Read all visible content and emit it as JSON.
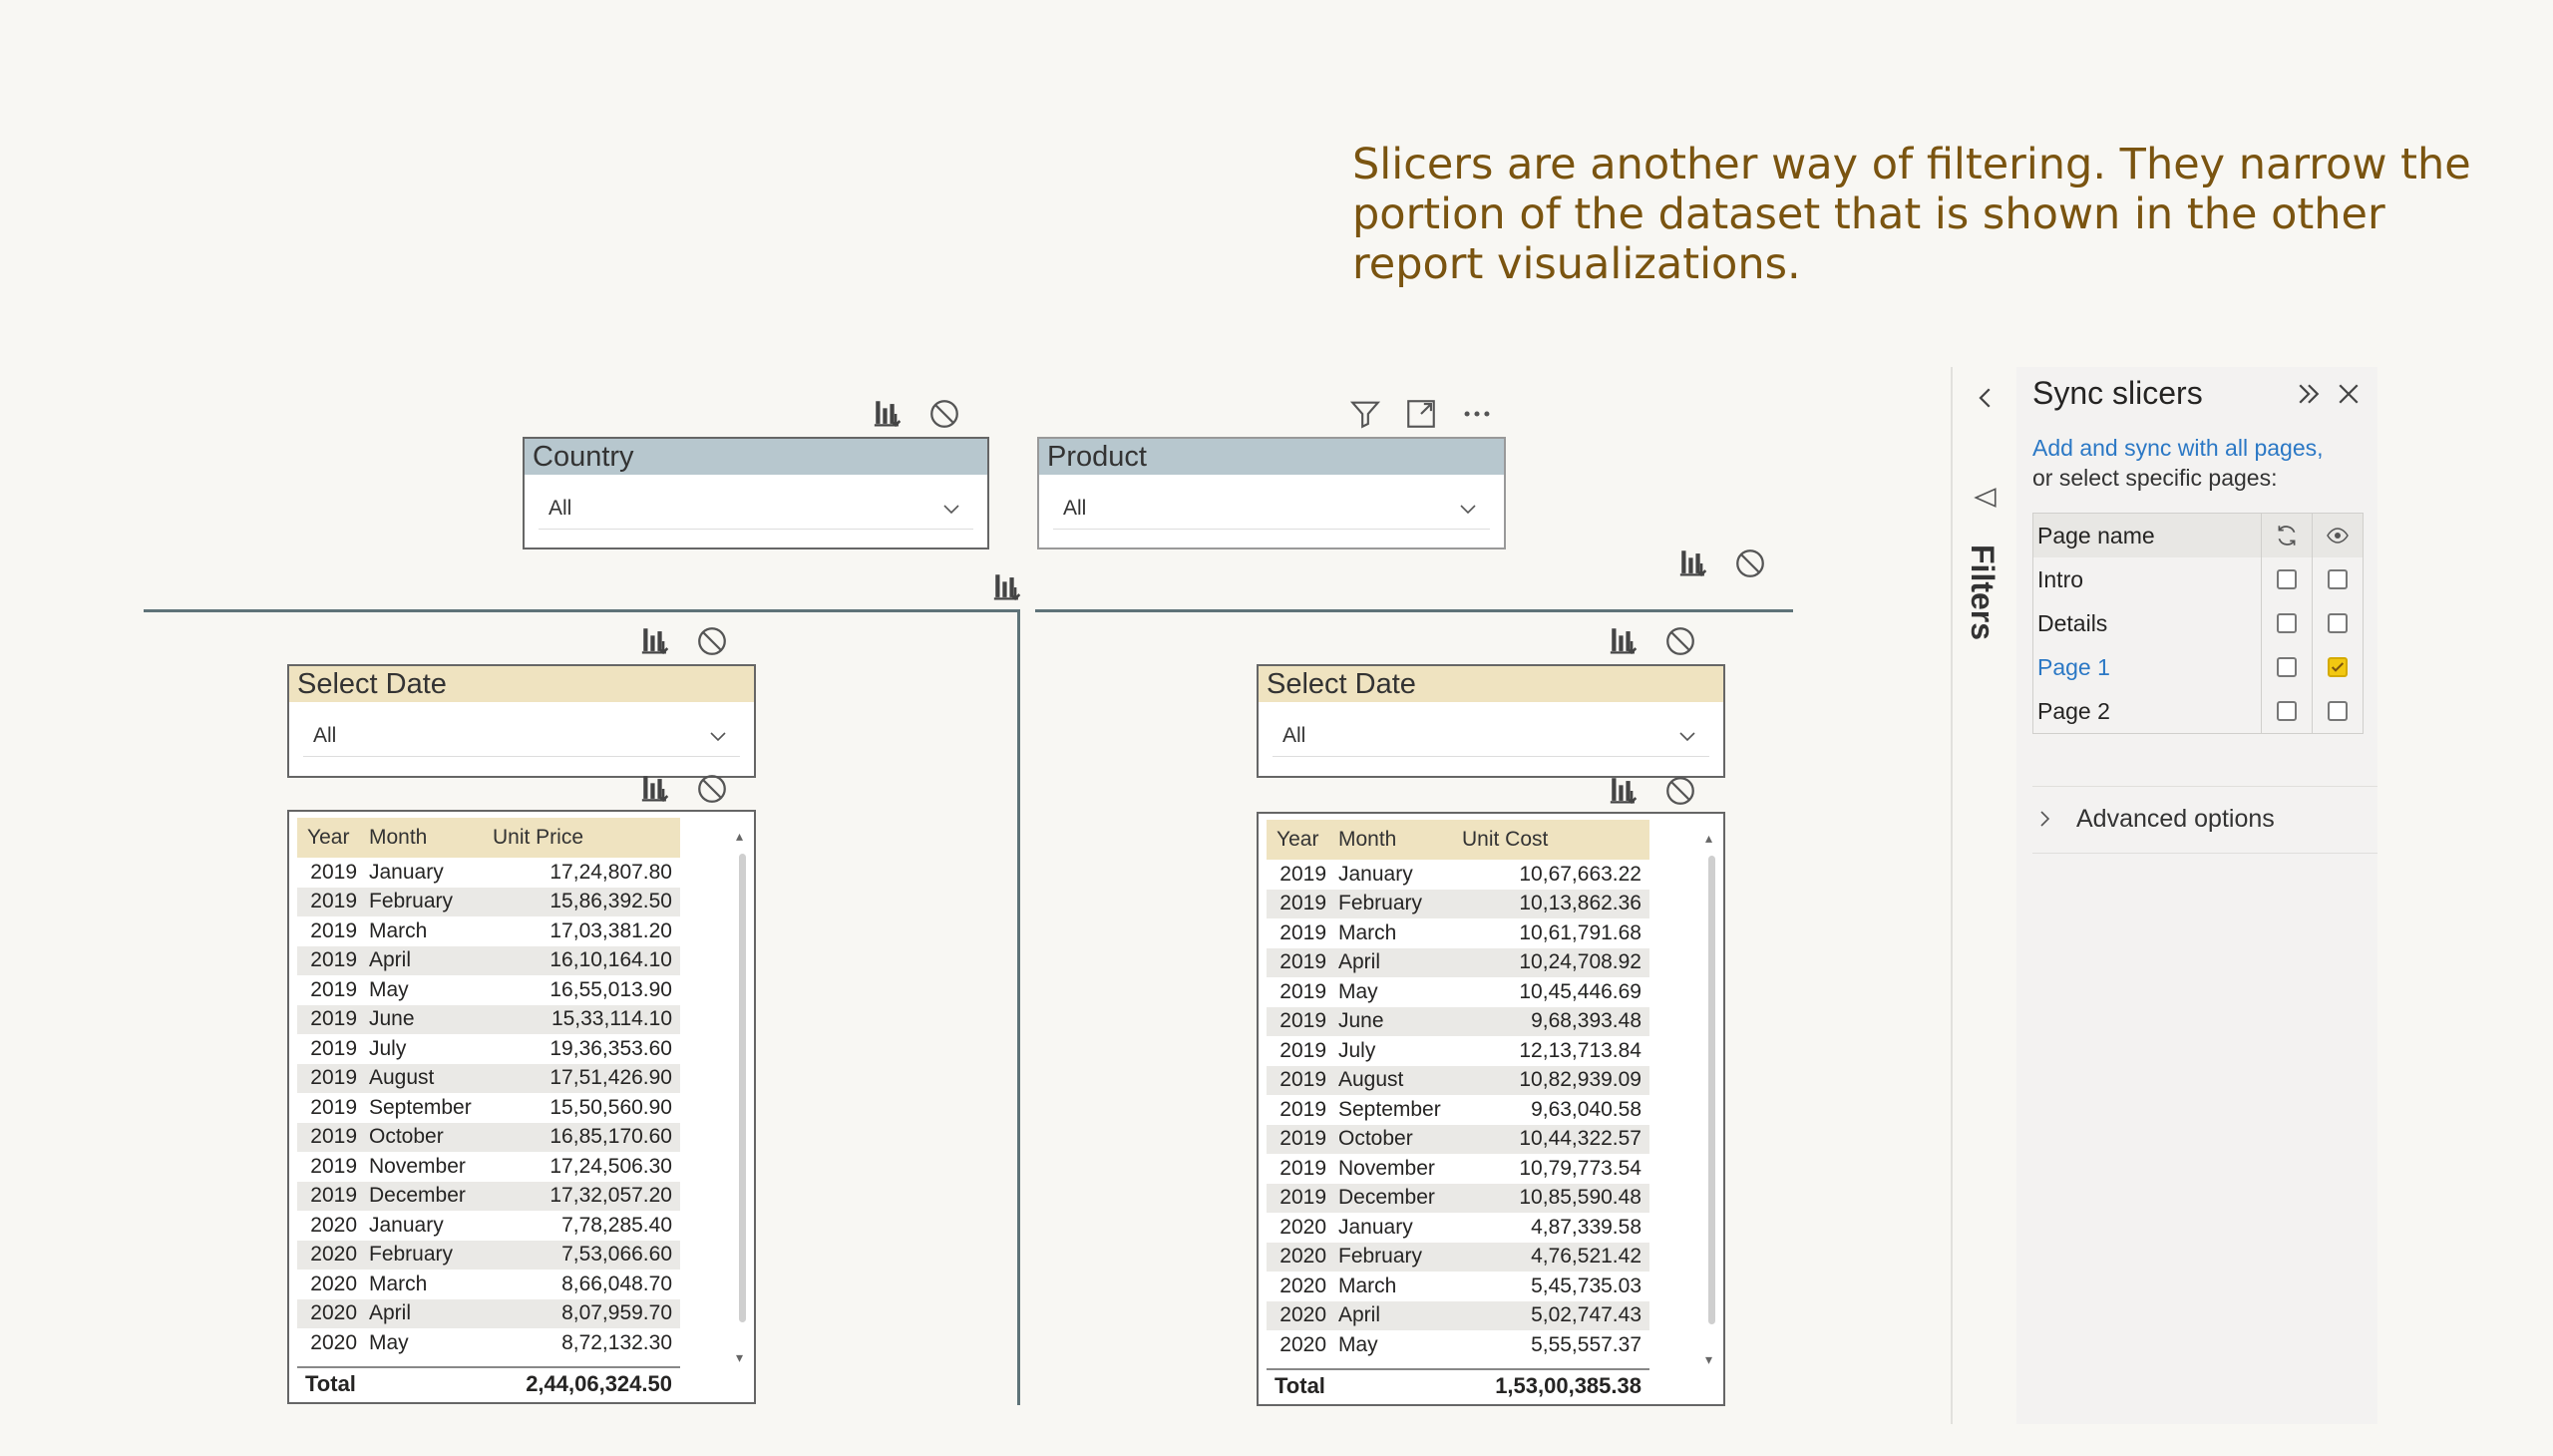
{
  "caption": "Slicers are another way of filtering. They narrow the portion of the dataset that is shown in the other report visualizations.",
  "slicers": {
    "country": {
      "title": "Country",
      "value": "All"
    },
    "product": {
      "title": "Product",
      "value": "All"
    },
    "date_left": {
      "title": "Select Date",
      "value": "All"
    },
    "date_right": {
      "title": "Select Date",
      "value": "All"
    }
  },
  "table_left": {
    "headers": [
      "Year",
      "Month",
      "Unit Price"
    ],
    "rows": [
      [
        "2019",
        "January",
        "17,24,807.80"
      ],
      [
        "2019",
        "February",
        "15,86,392.50"
      ],
      [
        "2019",
        "March",
        "17,03,381.20"
      ],
      [
        "2019",
        "April",
        "16,10,164.10"
      ],
      [
        "2019",
        "May",
        "16,55,013.90"
      ],
      [
        "2019",
        "June",
        "15,33,114.10"
      ],
      [
        "2019",
        "July",
        "19,36,353.60"
      ],
      [
        "2019",
        "August",
        "17,51,426.90"
      ],
      [
        "2019",
        "September",
        "15,50,560.90"
      ],
      [
        "2019",
        "October",
        "16,85,170.60"
      ],
      [
        "2019",
        "November",
        "17,24,506.30"
      ],
      [
        "2019",
        "December",
        "17,32,057.20"
      ],
      [
        "2020",
        "January",
        "7,78,285.40"
      ],
      [
        "2020",
        "February",
        "7,53,066.60"
      ],
      [
        "2020",
        "March",
        "8,66,048.70"
      ],
      [
        "2020",
        "April",
        "8,07,959.70"
      ],
      [
        "2020",
        "May",
        "8,72,132.30"
      ]
    ],
    "total_label": "Total",
    "total_value": "2,44,06,324.50"
  },
  "table_right": {
    "headers": [
      "Year",
      "Month",
      "Unit Cost"
    ],
    "rows": [
      [
        "2019",
        "January",
        "10,67,663.22"
      ],
      [
        "2019",
        "February",
        "10,13,862.36"
      ],
      [
        "2019",
        "March",
        "10,61,791.68"
      ],
      [
        "2019",
        "April",
        "10,24,708.92"
      ],
      [
        "2019",
        "May",
        "10,45,446.69"
      ],
      [
        "2019",
        "June",
        "9,68,393.48"
      ],
      [
        "2019",
        "July",
        "12,13,713.84"
      ],
      [
        "2019",
        "August",
        "10,82,939.09"
      ],
      [
        "2019",
        "September",
        "9,63,040.58"
      ],
      [
        "2019",
        "October",
        "10,44,322.57"
      ],
      [
        "2019",
        "November",
        "10,79,773.54"
      ],
      [
        "2019",
        "December",
        "10,85,590.48"
      ],
      [
        "2020",
        "January",
        "4,87,339.58"
      ],
      [
        "2020",
        "February",
        "4,76,521.42"
      ],
      [
        "2020",
        "March",
        "5,45,735.03"
      ],
      [
        "2020",
        "April",
        "5,02,747.43"
      ],
      [
        "2020",
        "May",
        "5,55,557.37"
      ]
    ],
    "total_label": "Total",
    "total_value": "1,53,00,385.38"
  },
  "filters_pane": {
    "label": "Filters"
  },
  "sync_panel": {
    "title": "Sync slicers",
    "link": "Add and sync with all pages,",
    "subtitle": "or select specific pages:",
    "column_header": "Page name",
    "pages": [
      {
        "name": "Intro",
        "sync": false,
        "visible": false,
        "active": false
      },
      {
        "name": "Details",
        "sync": false,
        "visible": false,
        "active": false
      },
      {
        "name": "Page 1",
        "sync": false,
        "visible": true,
        "active": true
      },
      {
        "name": "Page 2",
        "sync": false,
        "visible": false,
        "active": false
      }
    ],
    "advanced": "Advanced options"
  },
  "colors": {
    "caption": "#7a5410",
    "header_blue": "#b7c7ce",
    "header_tan": "#efe3c0",
    "link": "#2b78c5",
    "check": "#f2c811"
  }
}
